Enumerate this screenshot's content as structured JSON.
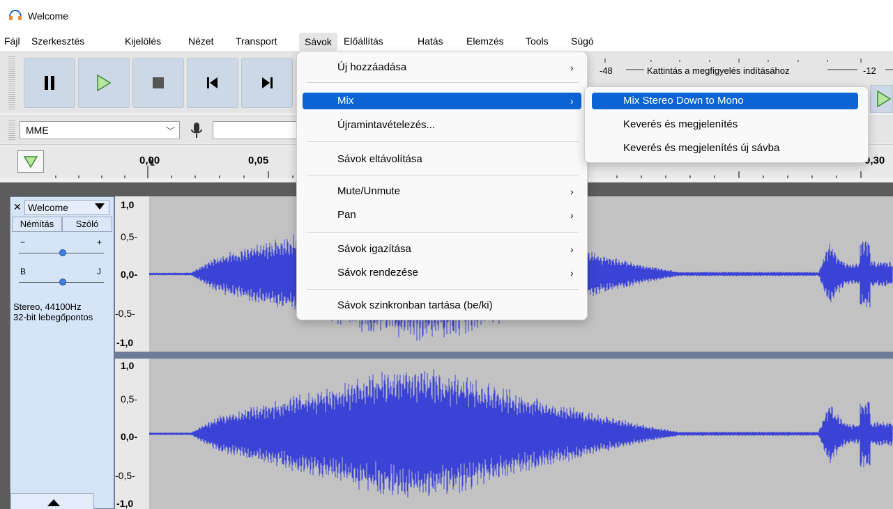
{
  "window": {
    "title": "Welcome"
  },
  "menubar": [
    "Fájl",
    "Szerkesztés",
    "Kijelölés",
    "Nézet",
    "Transport",
    "Sávok",
    "Előállítás",
    "Hatás",
    "Elemzés",
    "Tools",
    "Súgó"
  ],
  "active_menu": "Sávok",
  "meter": {
    "hint": "Kattintás a megfigyelés indításához",
    "scale_left": "-48",
    "scale_right": "-12"
  },
  "device": {
    "host": "MME"
  },
  "ruler": {
    "labels": [
      "0,00",
      "0,05",
      "0,30"
    ]
  },
  "track": {
    "name": "Welcome",
    "mute": "Némítás",
    "solo": "Szóló",
    "gain_minus": "−",
    "gain_plus": "+",
    "pan_left": "B",
    "pan_right": "J",
    "info_line1": "Stereo, 44100Hz",
    "info_line2": "32-bit lebegőpontos",
    "vruler_top": [
      "1,0",
      "0,5-",
      "0,0-",
      "-0,5-",
      "-1,0"
    ],
    "vruler_bottom": [
      "1,0",
      "0,5-",
      "0,0-",
      "-0,5-",
      "-1,0"
    ]
  },
  "tracks_menu": {
    "items": [
      {
        "label": "Új hozzáadása",
        "submenu": true
      },
      {
        "label": "Mix",
        "submenu": true,
        "highlighted": true
      },
      {
        "label": "Újramintavételezés...",
        "submenu": false
      },
      {
        "label": "Sávok eltávolítása",
        "submenu": false
      },
      {
        "label": "Mute/Unmute",
        "submenu": true
      },
      {
        "label": "Pan",
        "submenu": true
      },
      {
        "label": "Sávok igazítása",
        "submenu": true
      },
      {
        "label": "Sávok rendezése",
        "submenu": true
      },
      {
        "label": "Sávok szinkronban tartása (be/ki)",
        "submenu": false
      }
    ]
  },
  "mix_submenu": {
    "items": [
      {
        "label": "Mix Stereo Down to Mono",
        "highlighted": true
      },
      {
        "label": "Keverés és megjelenítés"
      },
      {
        "label": "Keverés és megjelenítés új sávba"
      }
    ]
  },
  "colors": {
    "accent": "#0a64d4",
    "waveform": "#3b43d6",
    "track_bg": "#c2c2c2",
    "panel": "#d6e4f8"
  }
}
